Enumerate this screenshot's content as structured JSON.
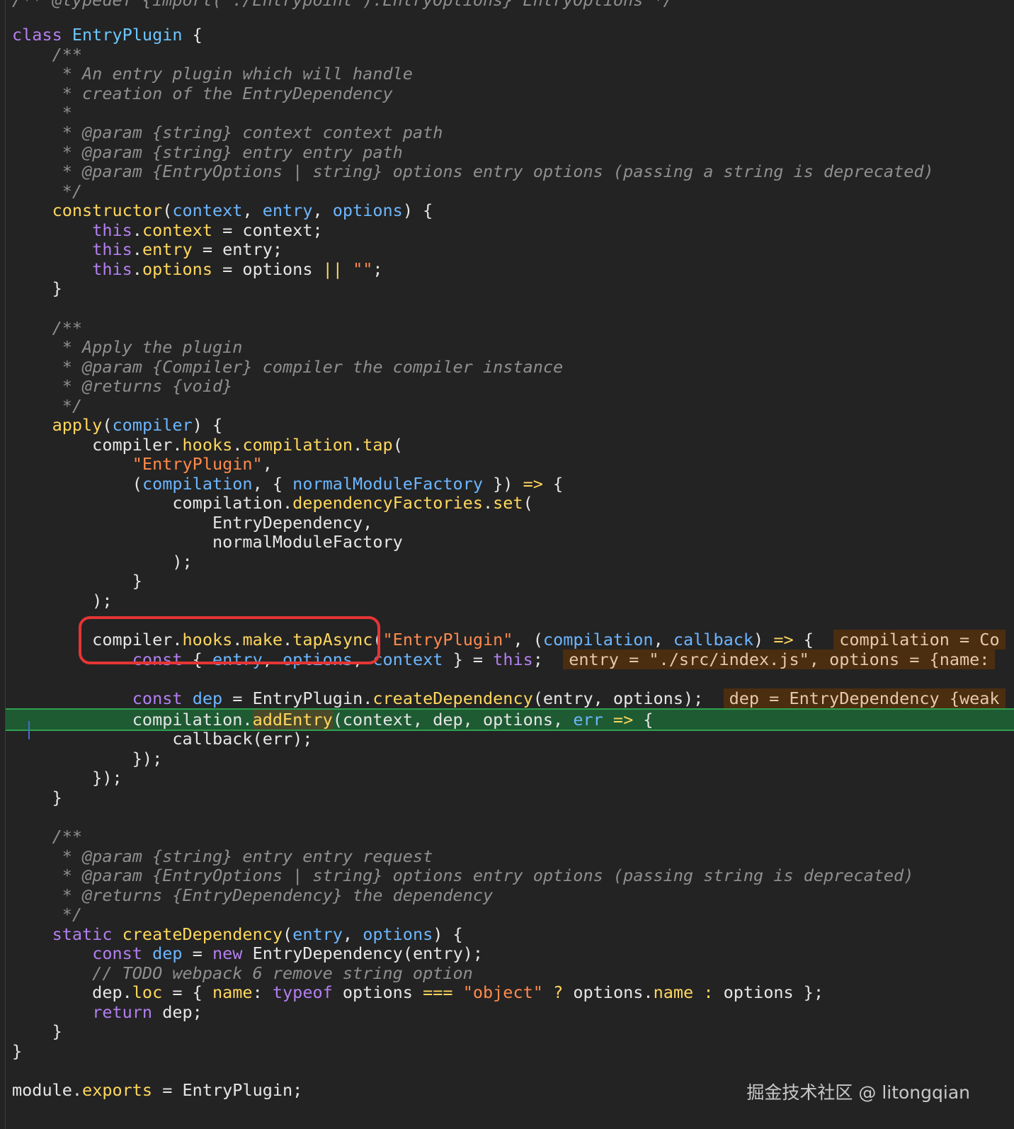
{
  "editor": {
    "top_partial_line": "/** @typedef {import(\"./Entrypoint\").EntryOptions} EntryOptions */",
    "lines": {
      "l_class": [
        "class ",
        "EntryPlugin",
        " {"
      ],
      "c1": "    /**",
      "c2": "     * An entry plugin which will handle",
      "c3": "     * creation of the EntryDependency",
      "c4": "     *",
      "c5": "     * @param {string} context context path",
      "c6": "     * @param {string} entry entry path",
      "c7": "     * @param {EntryOptions | string} options entry options (passing a string is deprecated)",
      "c8": "     */",
      "ctor": [
        "    ",
        "constructor",
        "(",
        "context",
        ", ",
        "entry",
        ", ",
        "options",
        ") {"
      ],
      "s1": [
        "        ",
        "this",
        ".",
        "context",
        " = context;"
      ],
      "s2": [
        "        ",
        "this",
        ".",
        "entry",
        " = entry;"
      ],
      "s3": [
        "        ",
        "this",
        ".",
        "options",
        " = options ",
        "||",
        " ",
        "\"\"",
        ";"
      ],
      "close1": "    }",
      "d1": "    /**",
      "d2": "     * Apply the plugin",
      "d3": "     * @param {Compiler} compiler the compiler instance",
      "d4": "     * @returns {void}",
      "d5": "     */",
      "apply": [
        "    ",
        "apply",
        "(",
        "compiler",
        ") {"
      ],
      "a1": [
        "        compiler.",
        "hooks",
        ".",
        "compilation",
        ".",
        "tap",
        "("
      ],
      "a2": [
        "            ",
        "\"EntryPlugin\"",
        ","
      ],
      "a3": [
        "            (",
        "compilation",
        ", { ",
        "normalModuleFactory",
        " }) ",
        "=>",
        " {"
      ],
      "a4": [
        "                compilation.",
        "dependencyFactories",
        ".",
        "set",
        "("
      ],
      "a5": "                    EntryDependency,",
      "a6": "                    normalModuleFactory",
      "a7": "                );",
      "a8": "            }",
      "a9": "        );",
      "m1": [
        "        compiler.",
        "hooks",
        ".",
        "make",
        ".",
        "tapAsync",
        "(",
        "\"EntryPlugin\"",
        ", (",
        "compilation",
        ", ",
        "callback",
        ") ",
        "=>",
        " {  "
      ],
      "m1_hint": "compilation = Co",
      "m2": [
        "            ",
        "const",
        " { ",
        "entry",
        ", ",
        "options",
        ", ",
        "context",
        " } = ",
        "this",
        ";  "
      ],
      "m2_hint": "entry = \"./src/index.js\", options = {name:",
      "m3": [
        "            ",
        "const",
        " ",
        "dep",
        " = EntryPlugin.",
        "createDependency",
        "(entry, options);  "
      ],
      "m3_hint": "dep = EntryDependency {weak",
      "m4": [
        "            compilation.",
        "addEntry",
        "(context, dep, options, ",
        "err",
        " ",
        "=>",
        " {"
      ],
      "m5": "                callback(err);",
      "m6": "            });",
      "m7": "        });",
      "close2": "    }",
      "e1": "    /**",
      "e2": "     * @param {string} entry entry request",
      "e3": "     * @param {EntryOptions | string} options entry options (passing string is deprecated)",
      "e4": "     * @returns {EntryDependency} the dependency",
      "e5": "     */",
      "st": [
        "    ",
        "static",
        " ",
        "createDependency",
        "(",
        "entry",
        ", ",
        "options",
        ") {"
      ],
      "st1": [
        "        ",
        "const",
        " ",
        "dep",
        " = ",
        "new",
        " EntryDependency(entry);"
      ],
      "st2": "        // TODO webpack 6 remove string option",
      "st3": [
        "        dep.",
        "loc",
        " = { ",
        "name",
        ": ",
        "typeof",
        " options ",
        "===",
        " ",
        "\"object\"",
        " ",
        "?",
        " options.",
        "name",
        " ",
        ":",
        " options };"
      ],
      "st4": [
        "        ",
        "return",
        " dep;"
      ],
      "close3": "    }",
      "close4": "}",
      "exp": [
        "module.",
        "exports",
        " = EntryPlugin;"
      ]
    }
  },
  "watermark": "掘金技术社区 @ litongqian"
}
